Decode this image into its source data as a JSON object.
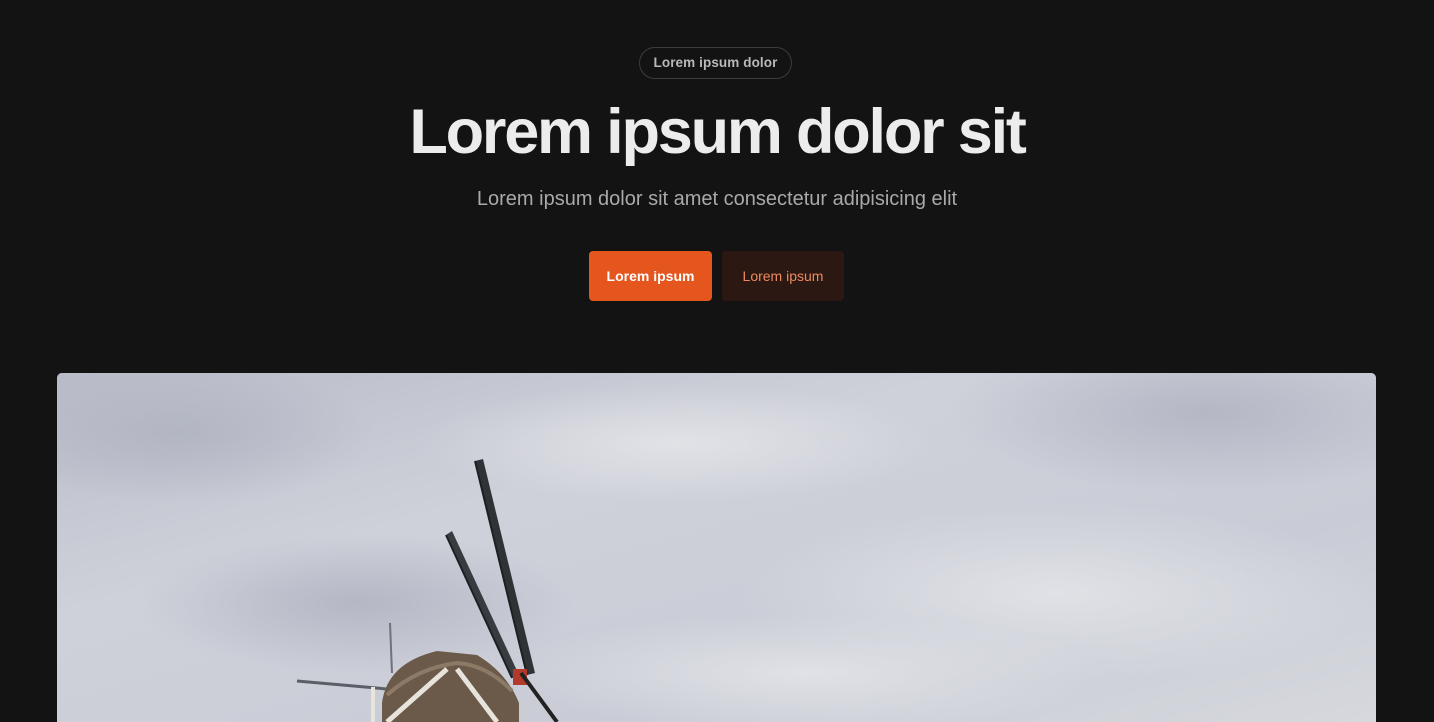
{
  "hero": {
    "badge": "Lorem ipsum dolor",
    "title": "Lorem ipsum dolor sit",
    "subtitle": "Lorem ipsum dolor sit amet consectetur adipisicing elit",
    "primary_button": "Lorem ipsum",
    "secondary_button": "Lorem ipsum"
  },
  "colors": {
    "background": "#131313",
    "accent": "#e4561d",
    "secondary_button_bg": "#2b1812",
    "secondary_button_text": "#ee8a5e"
  },
  "image": {
    "subject": "windmill-against-cloudy-sky"
  }
}
